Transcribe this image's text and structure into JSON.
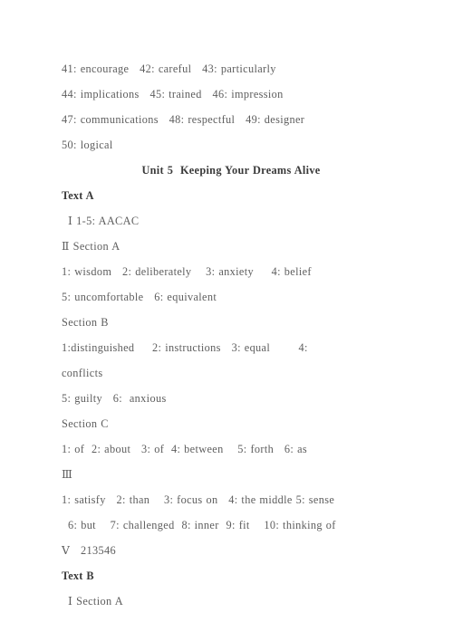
{
  "document": {
    "page_background": "#ffffff",
    "text_color": "#5e5e5e",
    "heading_color": "#3a3a3a",
    "lines": [
      {
        "id": "vocab-41-43",
        "text": "41: encourage   42: careful   43: particularly",
        "style": "normal"
      },
      {
        "id": "vocab-44-46",
        "text": "44: implications   45: trained   46: impression",
        "style": "normal"
      },
      {
        "id": "vocab-47-49",
        "text": "47: communications   48: respectful   49: designer",
        "style": "normal"
      },
      {
        "id": "vocab-50",
        "text": "50: logical",
        "style": "normal"
      },
      {
        "id": "unit-title",
        "text": "Unit 5  Keeping Your Dreams Alive",
        "style": "center"
      },
      {
        "id": "text-a-heading",
        "text": "Text A",
        "style": "bold"
      },
      {
        "id": "text-a-part-1",
        "text": "Ⅰ 1-5: AACAC",
        "style": "indent"
      },
      {
        "id": "text-a-part-2",
        "text": "Ⅱ Section A",
        "style": "normal"
      },
      {
        "id": "sec-a-answers-1",
        "text": "1: wisdom   2: deliberately    3: anxiety     4: belief",
        "style": "normal"
      },
      {
        "id": "sec-a-answers-2",
        "text": "5: uncomfortable   6: equivalent",
        "style": "normal"
      },
      {
        "id": "section-b-label",
        "text": "Section B",
        "style": "normal"
      },
      {
        "id": "sec-b-answers-1",
        "text": "1:distinguished     2: instructions   3: equal        4:",
        "style": "normal"
      },
      {
        "id": "sec-b-answers-2",
        "text": "conflicts",
        "style": "normal"
      },
      {
        "id": "sec-b-answers-3",
        "text": "5: guilty   6:  anxious",
        "style": "normal"
      },
      {
        "id": "section-c-label",
        "text": "Section C",
        "style": "normal"
      },
      {
        "id": "sec-c-answers",
        "text": "1: of  2: about   3: of  4: between    5: forth   6: as",
        "style": "normal"
      },
      {
        "id": "text-a-part-3",
        "text": "Ⅲ",
        "style": "normal"
      },
      {
        "id": "part-3-answers-1",
        "text": "1: satisfy   2: than    3: focus on   4: the middle 5: sense",
        "style": "normal"
      },
      {
        "id": "part-3-answers-2",
        "text": "6: but    7: challenged  8: inner  9: fit    10: thinking of",
        "style": "indent"
      },
      {
        "id": "text-a-part-5",
        "text": "Ⅴ   213546",
        "style": "normal"
      },
      {
        "id": "text-b-heading",
        "text": "Text B",
        "style": "bold"
      },
      {
        "id": "text-b-part-1",
        "text": "Ⅰ Section A",
        "style": "indent"
      }
    ]
  }
}
